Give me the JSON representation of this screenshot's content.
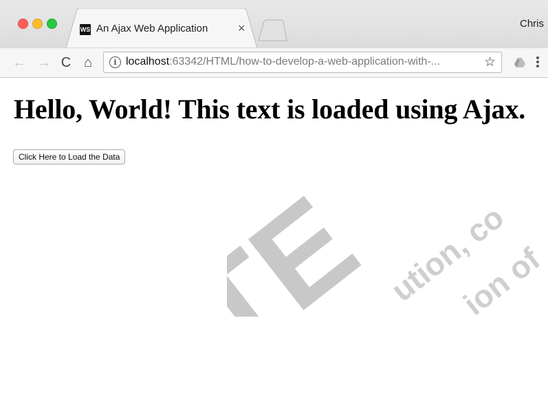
{
  "browser": {
    "tab": {
      "favicon_text": "WS",
      "title": "An Ajax Web Application",
      "close_glyph": "×"
    },
    "profile_name": "Chris",
    "toolbar": {
      "back_icon": "←",
      "forward_icon": "→",
      "reload_icon": "C",
      "home_icon": "⌂",
      "info_glyph": "i",
      "url_host": "localhost",
      "url_rest": ":63342/HTML/how-to-develop-a-web-application-with-...",
      "star_glyph": "☆"
    },
    "colors": {
      "close_red": "#fc5f57",
      "minimize_yellow": "#fdbc2e",
      "zoom_green": "#28c840"
    }
  },
  "page": {
    "heading": "Hello, World! This text is loaded using Ajax.",
    "button_label": "Click Here to Load the Data"
  },
  "watermark": {
    "large_text": "TE",
    "line1": "ution, co",
    "line2": "ion of"
  }
}
